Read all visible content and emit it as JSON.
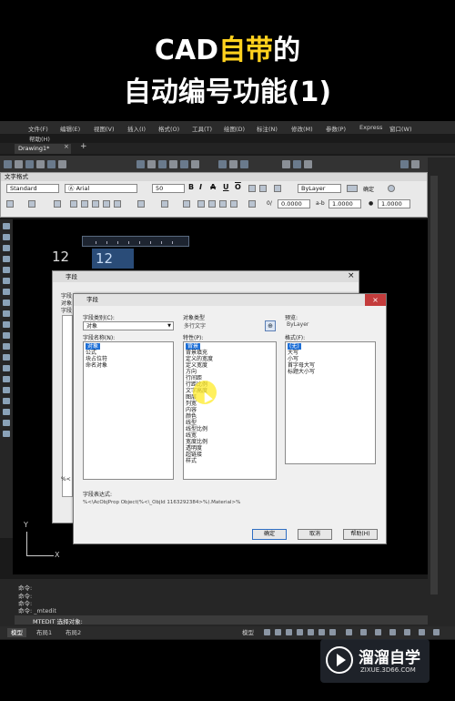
{
  "title": {
    "line1_prefix": "CAD",
    "line1_highlight": "自带",
    "line1_suffix": "的",
    "line2": "自动编号功能(1)"
  },
  "menu": [
    "文件(F)",
    "编辑(E)",
    "视图(V)",
    "插入(I)",
    "格式(O)",
    "工具(T)",
    "绘图(D)",
    "标注(N)",
    "修改(M)",
    "参数(P)",
    "Express",
    "窗口(W)",
    "帮助(H)"
  ],
  "file_tab": {
    "name": "Drawing1*",
    "close": "×",
    "add": "+"
  },
  "text_format": {
    "header": "文字格式",
    "style": "Standard",
    "font": "Arial",
    "height": "50",
    "layer": "ByLayer",
    "ok": "确定",
    "oblique": "0.0000",
    "tracking": "1.0000",
    "width": "1.0000",
    "bold": "B",
    "italic": "I",
    "strike": "A",
    "underline": "U",
    "overline": "O"
  },
  "canvas": {
    "text_12_left": "12",
    "text_12_selected": "12"
  },
  "back_dialog": {
    "title": "字段",
    "labels": [
      "字段",
      "对象",
      "字段",
      "公式",
      "格式"
    ],
    "expr_label": "%<"
  },
  "field_dialog": {
    "title": "字段",
    "close": "×",
    "category_label": "字段类别(C):",
    "category_value": "对象",
    "names_label": "字段名称(N):",
    "names": [
      "对象",
      "公式",
      "块占位符",
      "命名对象"
    ],
    "object_type_label": "对象类型",
    "object_type_value": "多行文字",
    "property_label": "特性(P):",
    "properties": [
      "背景",
      "背景填充",
      "定义的宽度",
      "定义宽度",
      "方向",
      "行间距",
      "行距比例",
      "文字高度",
      "图层",
      "列宽",
      "内容",
      "颜色",
      "线型",
      "线型比例",
      "线宽",
      "宽度比例",
      "透明度",
      "超链接",
      "样式"
    ],
    "preview_label": "预览:",
    "preview_value": "ByLayer",
    "format_label": "格式(F):",
    "formats": [
      "(无)",
      "大写",
      "小写",
      "首字母大写",
      "标题大小写"
    ],
    "expr_label": "字段表达式:",
    "expr_value": "%<\\AcObjProp Object(%<\\_ObjId 1163292384>%).Material>%",
    "ok": "确定",
    "cancel": "取消",
    "help": "帮助(H)"
  },
  "ucs": {
    "y": "Y",
    "x": "X"
  },
  "command": {
    "lines": [
      "命令:",
      "命令:",
      "命令:",
      "命令: _mtedit"
    ],
    "input": "MTEDIT 选择对象:"
  },
  "status_tabs": [
    "模型",
    "布局1",
    "布局2"
  ],
  "status_model": "模型",
  "watermark": {
    "brand": "溜溜自学",
    "url": "ZIXUE.3D66.COM"
  }
}
